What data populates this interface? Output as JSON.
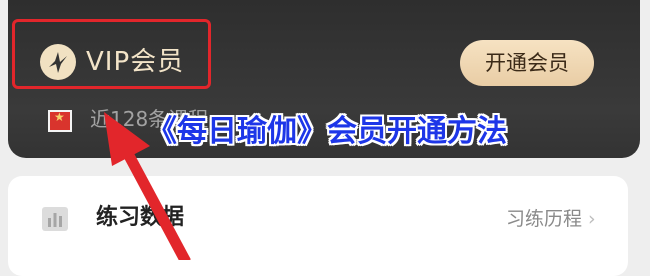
{
  "vip_card": {
    "logo_icon": "yoga-pose-logo-icon",
    "title": "VIP会员",
    "open_button_label": "开通会员",
    "badge_icon": "red-star-badge-icon",
    "courses_text": "近128条课程"
  },
  "overlay": {
    "title": "《每日瑜伽》会员开通方法"
  },
  "stats_card": {
    "icon": "bar-chart-icon",
    "label": "练习数据",
    "history_link": "习练历程",
    "chevron_icon": "chevron-right-icon"
  },
  "annotations": {
    "highlight_color": "#e2262b",
    "overlay_text_color": "#1d36e8"
  }
}
